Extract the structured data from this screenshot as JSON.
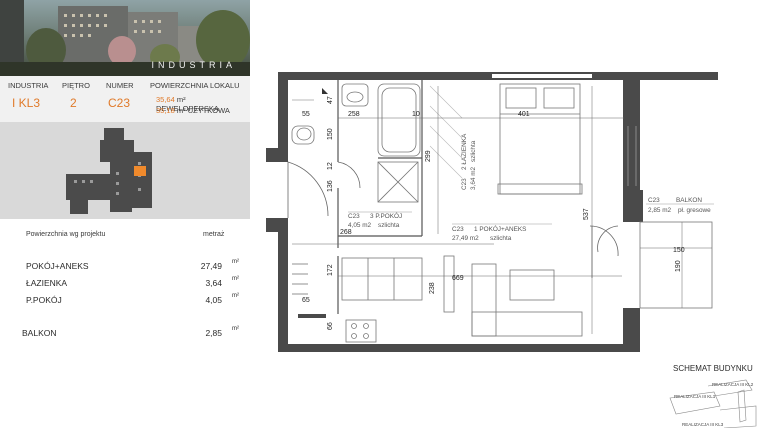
{
  "brand": "INDUSTRIA",
  "info": {
    "headers": [
      "INDUSTRIA",
      "PIĘTRO",
      "NUMER",
      "POWIERZCHNIA LOKALU"
    ],
    "industria": "I KL3",
    "pietro": "2",
    "numer": "C23",
    "area_dev_value": "35,64",
    "area_dev_label": "m² DEWELOPERSKA",
    "area_use_value": "35,18",
    "area_use_label": "m² UŻYTKOWA"
  },
  "rooms_table": {
    "header_left": "Powierzchnia wg projektu",
    "header_right": "metraż",
    "unit": "m²",
    "rows": [
      {
        "name": "POKÓJ+ANEKS",
        "value": "27,49"
      },
      {
        "name": "ŁAZIENKA",
        "value": "3,64"
      },
      {
        "name": "P.POKÓJ",
        "value": "4,05"
      },
      {
        "name": "BALKON",
        "value": "2,85"
      }
    ]
  },
  "plan": {
    "rooms": [
      {
        "code": "C23",
        "name": "1 POKÓJ+ANEKS",
        "area": "27,49 m2",
        "finish": "szlichta"
      },
      {
        "code": "C23",
        "name": "2 ŁAZIENKA",
        "area": "3,64 m2",
        "finish": "szlichta"
      },
      {
        "code": "C23",
        "name": "3 P.POKÓJ",
        "area": "4,05 m2",
        "finish": "szlichta"
      },
      {
        "code": "C23",
        "name": "BALKON",
        "area": "2,85 m2",
        "finish": "pł. gresowe"
      }
    ],
    "dims": {
      "d55": "55",
      "d258": "258",
      "d10": "10",
      "d401": "401",
      "d150a": "150",
      "d12": "12",
      "d136": "136",
      "d299": "299",
      "d537": "537",
      "d268": "268",
      "d172": "172",
      "d238": "238",
      "d669": "669",
      "d65": "65",
      "d66": "66",
      "d150b": "150",
      "d190": "190",
      "d47": "47"
    }
  },
  "schema": {
    "title": "SCHEMAT BUDYNKU",
    "labels": [
      "REALIZACJA III KL2",
      "REALIZACJA III KL1",
      "REALIZACJA III KL3"
    ]
  },
  "colors": {
    "accent": "#e07a2a",
    "wall": "#4a4a4a",
    "panel": "#f1f1f1",
    "keyplan_bg": "#d9d9d9",
    "highlight": "#f08a2c"
  }
}
